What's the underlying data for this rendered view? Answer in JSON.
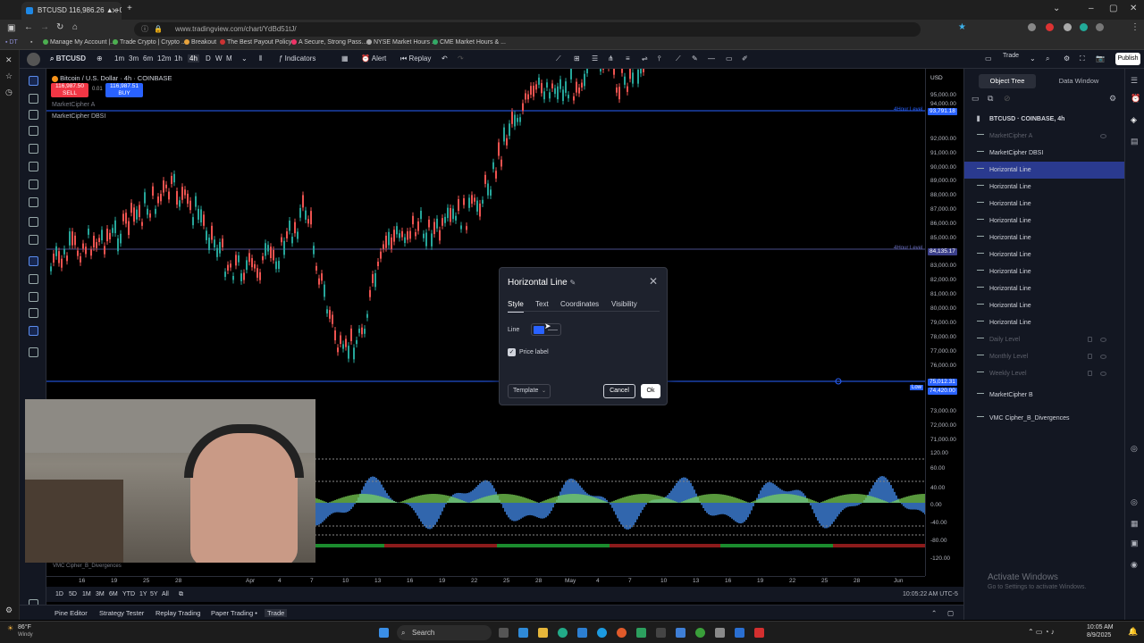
{
  "browser": {
    "tab_title": "BTCUSD 116,986.26 ▲ +0.26%",
    "url": "www.tradingview.com/chart/YdBd51tJ/",
    "bookmarks": [
      "Manage My Account |...",
      "Trade Crypto | Crypto ...",
      "Breakout",
      "The Best Payout Policy...",
      "A Secure, Strong Pass...",
      "NYSE Market Hours ...",
      "CME Market Hours & ..."
    ]
  },
  "toolbar": {
    "symbol": "BTCUSD",
    "intervals": [
      "1m",
      "3m",
      "6m",
      "12m",
      "1h",
      "4h",
      "D",
      "W",
      "M"
    ],
    "indicators": "Indicators",
    "alert": "Alert",
    "replay": "Replay",
    "trade": "Trade",
    "publish": "Publish"
  },
  "chart": {
    "title": "Bitcoin / U.S. Dollar · 4h · COINBASE",
    "sell_price": "116,987.50",
    "sell_label": "SELL",
    "spread": "0.01",
    "buy_price": "116,987.51",
    "buy_label": "BUY",
    "indicator1": "MarketCipher A",
    "indicator2": "MarketCipher DBSI",
    "currency": "USD",
    "hour_level_1": "4Hour Level",
    "hour_level_2": "4Hour Level",
    "low_label": "Low",
    "bottom_indicator": "VMC Cipher_B_Divergences"
  },
  "price_axis": [
    "95,000.00",
    "94,000.00",
    "93,791.18",
    "92,000.00",
    "91,000.00",
    "90,000.00",
    "89,000.00",
    "88,000.00",
    "87,000.00",
    "86,000.00",
    "85,000.00",
    "84,135.17",
    "83,000.00",
    "82,000.00",
    "81,000.00",
    "80,000.00",
    "79,000.00",
    "78,000.00",
    "77,000.00",
    "76,000.00",
    "75,012.31",
    "74,420.00",
    "73,000.00",
    "72,000.00",
    "71,000.00"
  ],
  "osc_axis": [
    "120.00",
    "60.00",
    "40.00",
    "0.00",
    "-40.00",
    "-80.00",
    "-120.00"
  ],
  "time_axis": [
    "16",
    "19",
    "25",
    "28",
    "Apr",
    "4",
    "7",
    "10",
    "13",
    "16",
    "19",
    "22",
    "25",
    "28",
    "May",
    "4",
    "7",
    "10",
    "13",
    "16",
    "19",
    "22",
    "25",
    "28",
    "Jun"
  ],
  "range_bar": {
    "ranges": [
      "1D",
      "5D",
      "1M",
      "3M",
      "6M",
      "YTD",
      "1Y",
      "5Y",
      "All"
    ],
    "clock": "10:05:22 AM UTC-5"
  },
  "bottom_tabs": [
    "Pine Editor",
    "Strategy Tester",
    "Replay Trading",
    "Paper Trading •",
    "Trade"
  ],
  "right_panel": {
    "tab_object_tree": "Object Tree",
    "tab_data_window": "Data Window",
    "symbol_row": "BTCUSD · COINBASE, 4h",
    "rows": [
      {
        "label": "MarketCipher A",
        "state": "dim"
      },
      {
        "label": "MarketCipher DBSI",
        "state": "normal"
      },
      {
        "label": "Horizontal Line",
        "state": "selected"
      },
      {
        "label": "Horizontal Line",
        "state": "normal"
      },
      {
        "label": "Horizontal Line",
        "state": "normal"
      },
      {
        "label": "Horizontal Line",
        "state": "normal"
      },
      {
        "label": "Horizontal Line",
        "state": "normal"
      },
      {
        "label": "Horizontal Line",
        "state": "normal"
      },
      {
        "label": "Horizontal Line",
        "state": "normal"
      },
      {
        "label": "Horizontal Line",
        "state": "normal"
      },
      {
        "label": "Horizontal Line",
        "state": "normal"
      },
      {
        "label": "Horizontal Line",
        "state": "normal"
      },
      {
        "label": "Daily Level",
        "state": "dim"
      },
      {
        "label": "Monthly Level",
        "state": "dim"
      },
      {
        "label": "Weekly Level",
        "state": "dim"
      },
      {
        "label": "MarketCipher B",
        "state": "normal"
      },
      {
        "label": "VMC Cipher_B_Divergences",
        "state": "normal"
      }
    ],
    "activate_title": "Activate Windows",
    "activate_sub": "Go to Settings to activate Windows."
  },
  "dialog": {
    "title": "Horizontal Line",
    "tabs": [
      "Style",
      "Text",
      "Coordinates",
      "Visibility"
    ],
    "line_label": "Line",
    "line_color": "#2962ff",
    "price_label": "Price label",
    "price_label_checked": true,
    "template": "Template",
    "cancel": "Cancel",
    "ok": "Ok"
  },
  "taskbar": {
    "weather": "86°F",
    "weather_sub": "Windy",
    "search": "Search",
    "time": "10:05 AM",
    "date": "8/9/2025"
  },
  "colors": {
    "accent": "#2962ff",
    "sell": "#f23645",
    "buy": "#2962ff",
    "bull": "#26a69a",
    "bear": "#ef5350"
  }
}
